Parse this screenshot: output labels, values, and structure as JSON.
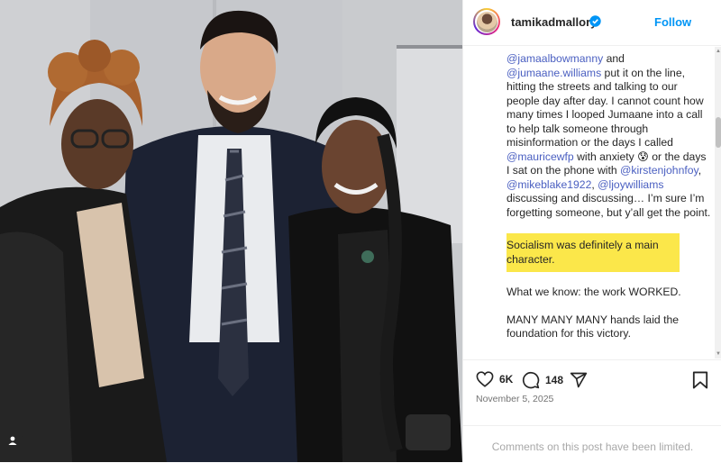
{
  "header": {
    "username": "tamikadmallory",
    "follow_label": "Follow"
  },
  "caption": {
    "para1": {
      "mention1": "@jamaalbowmanny",
      "text1": " and ",
      "mention2": "@jumaane.williams",
      "text2": " put it on the line, hitting the streets and talking to our people day after day. I cannot count how many times I looped Jumaane into a call to help talk someone through misinformation or the days I called ",
      "mention3": "@mauricewfp",
      "text3": " with anxiety 😰 or the days I sat on the phone with ",
      "mention4": "@kirstenjohnfoy",
      "text4": ", ",
      "mention5": "@mikeblake1922",
      "text5": ", ",
      "mention6": "@ljoywilliams",
      "text6": " discussing and discussing… I’m sure I’m forgetting someone, but y’all get the point."
    },
    "highlight": "Socialism was definitely a main character.",
    "para3": "What we know: the work WORKED.",
    "para4": "MANY MANY MANY hands laid the foundation for this victory."
  },
  "actions": {
    "likes": "6K",
    "comments": "148"
  },
  "date": "November 5, 2025",
  "footer": {
    "limited": "Comments on this post have been limited."
  },
  "colors": {
    "link": "#4a5fc1",
    "follow": "#0095f6",
    "highlight": "#fbe74a"
  },
  "icons": [
    "user-tag-icon",
    "verified-badge-icon",
    "heart-icon",
    "comment-icon",
    "share-icon",
    "bookmark-icon"
  ]
}
